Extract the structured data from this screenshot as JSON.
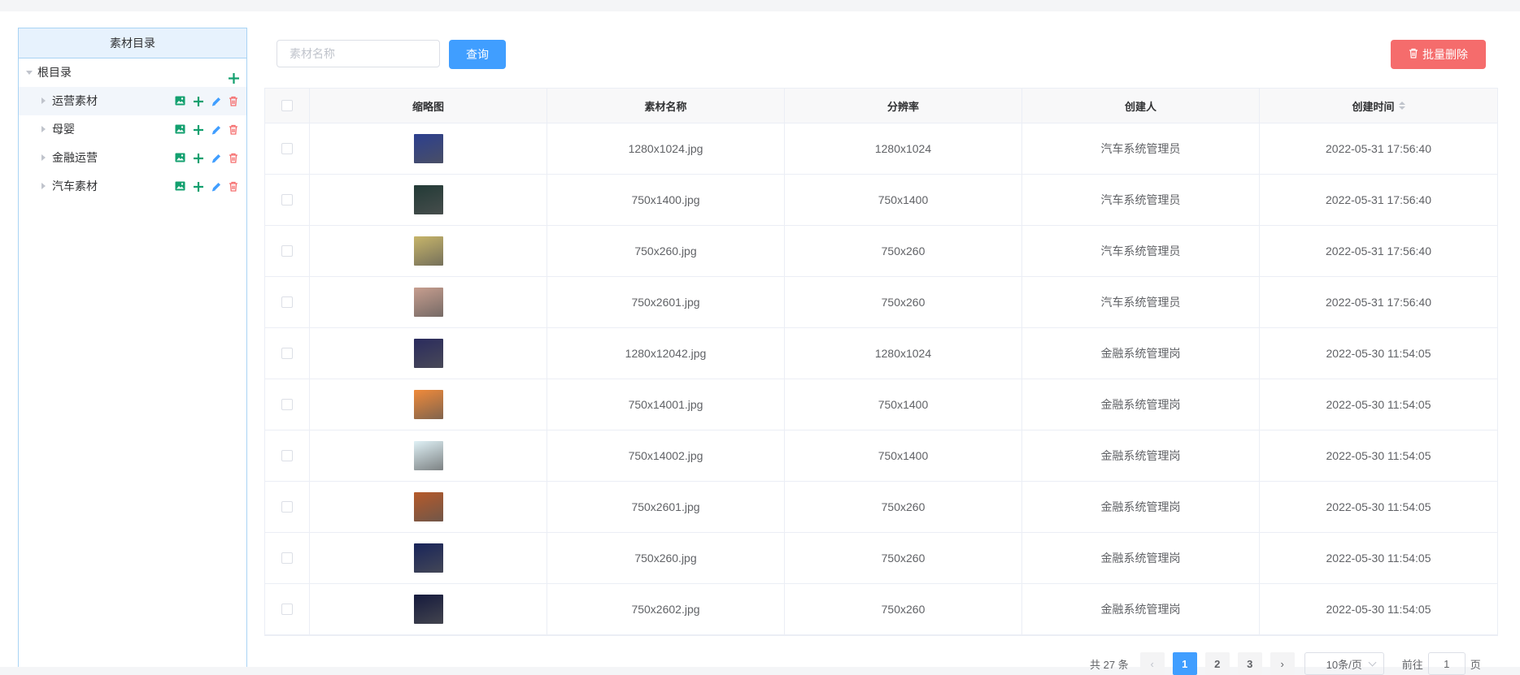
{
  "tree": {
    "header": "素材目录",
    "root": {
      "label": "根目录"
    },
    "children": [
      {
        "label": "运营素材"
      },
      {
        "label": "母婴"
      },
      {
        "label": "金融运营"
      },
      {
        "label": "汽车素材"
      }
    ]
  },
  "toolbar": {
    "search_placeholder": "素材名称",
    "search_value": "",
    "query_label": "查询",
    "batch_delete_label": "批量删除"
  },
  "table": {
    "columns": [
      "缩略图",
      "素材名称",
      "分辨率",
      "创建人",
      "创建时间"
    ],
    "rows": [
      {
        "thumb_color": "#2c3f8f",
        "name": "1280x1024.jpg",
        "resolution": "1280x1024",
        "creator": "汽车系统管理员",
        "created": "2022-05-31 17:56:40"
      },
      {
        "thumb_color": "#223a36",
        "name": "750x1400.jpg",
        "resolution": "750x1400",
        "creator": "汽车系统管理员",
        "created": "2022-05-31 17:56:40"
      },
      {
        "thumb_color": "#c7b56a",
        "name": "750x260.jpg",
        "resolution": "750x260",
        "creator": "汽车系统管理员",
        "created": "2022-05-31 17:56:40"
      },
      {
        "thumb_color": "#c79e8f",
        "name": "750x2601.jpg",
        "resolution": "750x260",
        "creator": "汽车系统管理员",
        "created": "2022-05-31 17:56:40"
      },
      {
        "thumb_color": "#2a2b5e",
        "name": "1280x12042.jpg",
        "resolution": "1280x1024",
        "creator": "金融系统管理岗",
        "created": "2022-05-30 11:54:05"
      },
      {
        "thumb_color": "#f08a3a",
        "name": "750x14001.jpg",
        "resolution": "750x1400",
        "creator": "金融系统管理岗",
        "created": "2022-05-30 11:54:05"
      },
      {
        "thumb_color": "#dff1f6",
        "name": "750x14002.jpg",
        "resolution": "750x1400",
        "creator": "金融系统管理岗",
        "created": "2022-05-30 11:54:05"
      },
      {
        "thumb_color": "#b65a2a",
        "name": "750x2601.jpg",
        "resolution": "750x260",
        "creator": "金融系统管理岗",
        "created": "2022-05-30 11:54:05"
      },
      {
        "thumb_color": "#18245a",
        "name": "750x260.jpg",
        "resolution": "750x260",
        "creator": "金融系统管理岗",
        "created": "2022-05-30 11:54:05"
      },
      {
        "thumb_color": "#151a3d",
        "name": "750x2602.jpg",
        "resolution": "750x260",
        "creator": "金融系统管理岗",
        "created": "2022-05-30 11:54:05"
      }
    ]
  },
  "pagination": {
    "total_text": "共 27 条",
    "pages": [
      "1",
      "2",
      "3"
    ],
    "current": "1",
    "page_size": "10条/页",
    "goto_prefix": "前往",
    "goto_value": "1",
    "goto_suffix": "页"
  },
  "colors": {
    "primary": "#409eff",
    "danger": "#f56c6c",
    "success": "#13a06f",
    "tree_border": "#a9d3f4"
  },
  "icons": {
    "tree_actions": [
      "image-icon",
      "plus-icon",
      "edit-icon",
      "delete-icon"
    ],
    "root_action": "plus-icon",
    "batch_delete": "trash-icon"
  }
}
